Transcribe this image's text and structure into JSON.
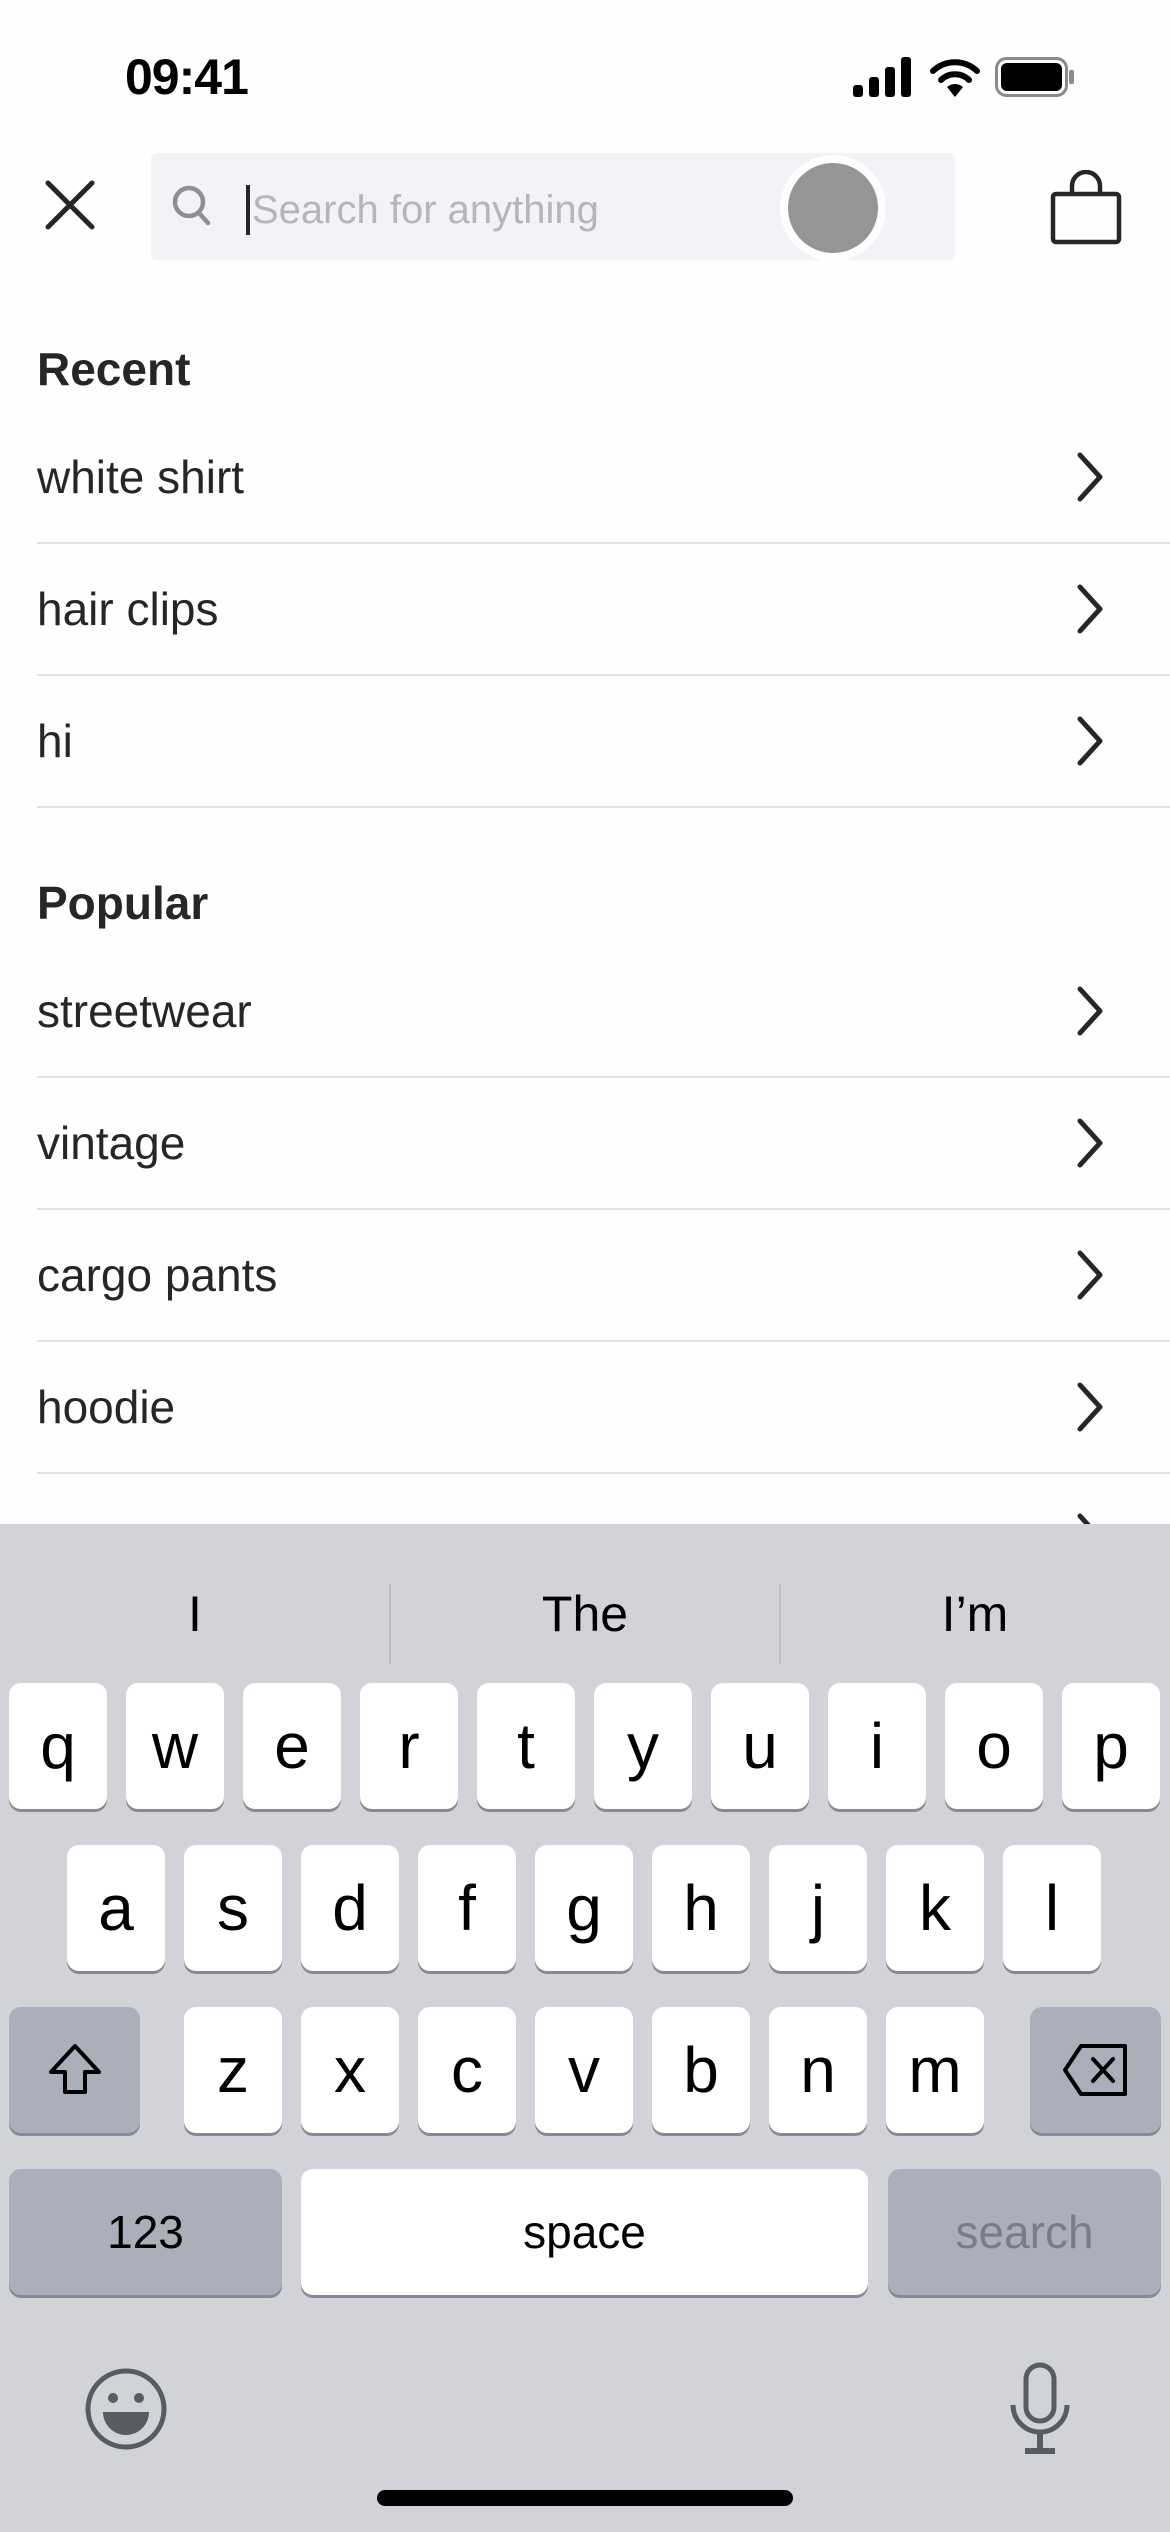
{
  "status_bar": {
    "time": "09:41",
    "icons": [
      "cellular-signal-icon",
      "wifi-icon",
      "battery-icon"
    ]
  },
  "header": {
    "close_icon": "close-icon",
    "search": {
      "icon": "search-icon",
      "value": "",
      "placeholder": "Search for anything"
    },
    "bag_icon": "shopping-bag-icon"
  },
  "recent": {
    "title": "Recent",
    "items": [
      {
        "label": "white shirt"
      },
      {
        "label": "hair clips"
      },
      {
        "label": "hi"
      }
    ]
  },
  "popular": {
    "title": "Popular",
    "items": [
      {
        "label": "streetwear"
      },
      {
        "label": "vintage"
      },
      {
        "label": "cargo pants"
      },
      {
        "label": "hoodie"
      }
    ]
  },
  "keyboard": {
    "suggestions": [
      "I",
      "The",
      "I’m"
    ],
    "row1": [
      "q",
      "w",
      "e",
      "r",
      "t",
      "y",
      "u",
      "i",
      "o",
      "p"
    ],
    "row2": [
      "a",
      "s",
      "d",
      "f",
      "g",
      "h",
      "j",
      "k",
      "l"
    ],
    "row3": [
      "z",
      "x",
      "c",
      "v",
      "b",
      "n",
      "m"
    ],
    "numbers_label": "123",
    "space_label": "space",
    "return_label": "search"
  },
  "colors": {
    "background": "#fefefe",
    "text": "#262626",
    "search_bg": "#f3f2f6",
    "keyboard_bg": "#d2d3d9",
    "divider": "#e2e1e6"
  }
}
